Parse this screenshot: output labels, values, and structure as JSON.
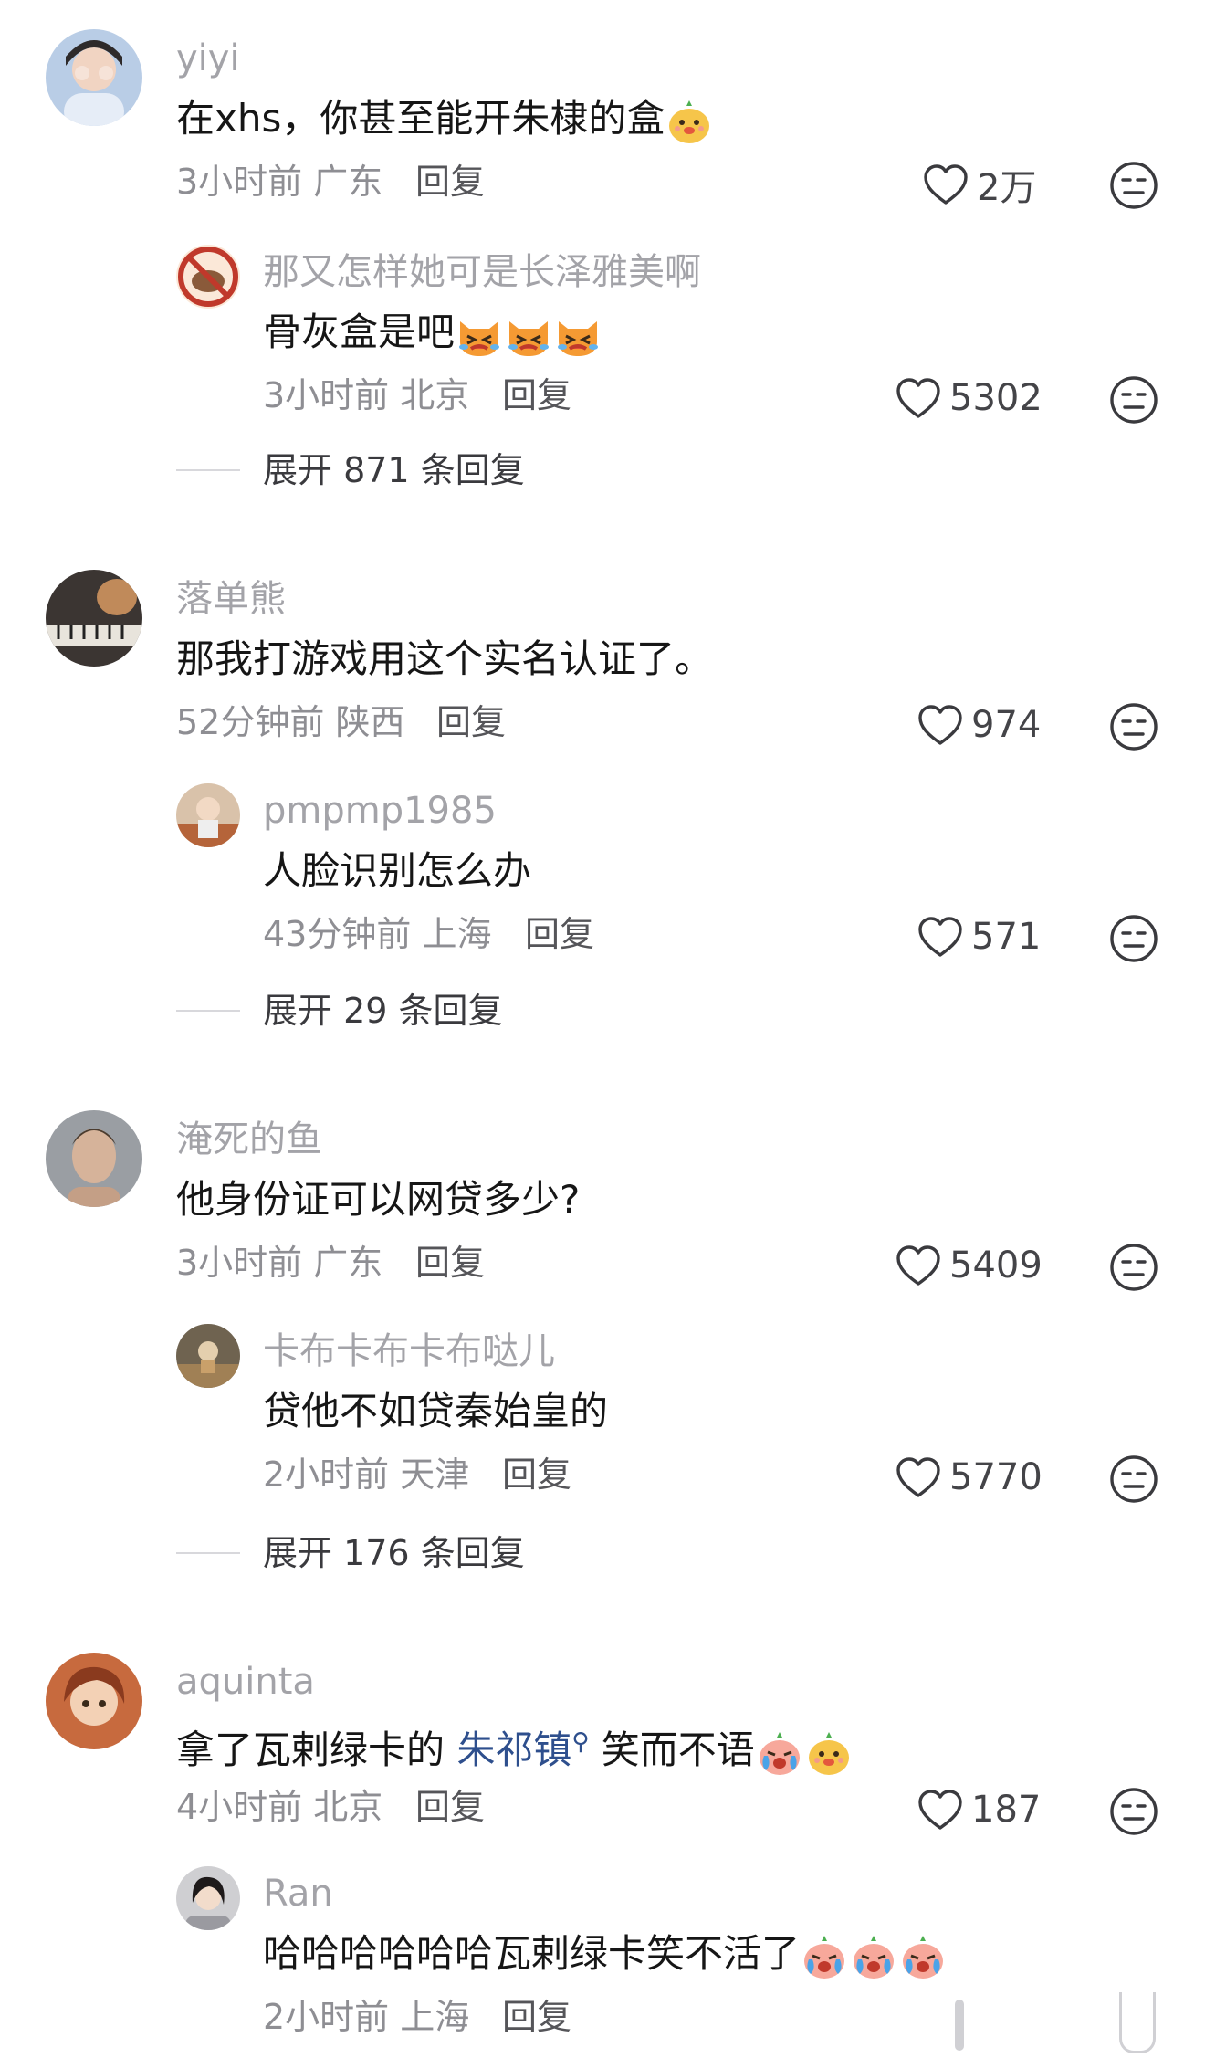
{
  "comments": [
    {
      "user": "yiyi",
      "text": "在xhs，你甚至能开朱棣的盒",
      "time": "3小时前",
      "location": "广东",
      "reply_label": "回复",
      "likes": "2万",
      "replies": [
        {
          "user": "那又怎样她可是长泽雅美啊",
          "text": "骨灰盒是吧",
          "time": "3小时前",
          "location": "北京",
          "reply_label": "回复",
          "likes": "5302"
        }
      ],
      "expand": "展开 871 条回复"
    },
    {
      "user": "落单熊",
      "text": "那我打游戏用这个实名认证了。",
      "time": "52分钟前",
      "location": "陕西",
      "reply_label": "回复",
      "likes": "974",
      "replies": [
        {
          "user": "pmpmp1985",
          "text": "人脸识别怎么办",
          "time": "43分钟前",
          "location": "上海",
          "reply_label": "回复",
          "likes": "571"
        }
      ],
      "expand": "展开 29 条回复"
    },
    {
      "user": "淹死的鱼",
      "text": "他身份证可以网贷多少?",
      "time": "3小时前",
      "location": "广东",
      "reply_label": "回复",
      "likes": "5409",
      "replies": [
        {
          "user": "卡布卡布卡布哒儿",
          "text": "贷他不如贷秦始皇的",
          "time": "2小时前",
          "location": "天津",
          "reply_label": "回复",
          "likes": "5770"
        }
      ],
      "expand": "展开 176 条回复"
    },
    {
      "user": "aquinta",
      "text_prefix": "拿了瓦剌绿卡的 ",
      "text_link": "朱祁镇",
      "text_suffix": " 笑而不语",
      "time": "4小时前",
      "location": "北京",
      "reply_label": "回复",
      "likes": "187",
      "replies": [
        {
          "user": "Ran",
          "text": "哈哈哈哈哈哈瓦剌绿卡笑不活了",
          "time": "2小时前",
          "location": "上海",
          "reply_label": "回复"
        }
      ]
    }
  ],
  "icons": {
    "like": "heart-outline-icon",
    "dislike": "neutral-face-icon",
    "search": "search-icon"
  },
  "colors": {
    "link": "#2e4f8d",
    "name": "#a3a3a8",
    "meta": "#8e8e93"
  }
}
